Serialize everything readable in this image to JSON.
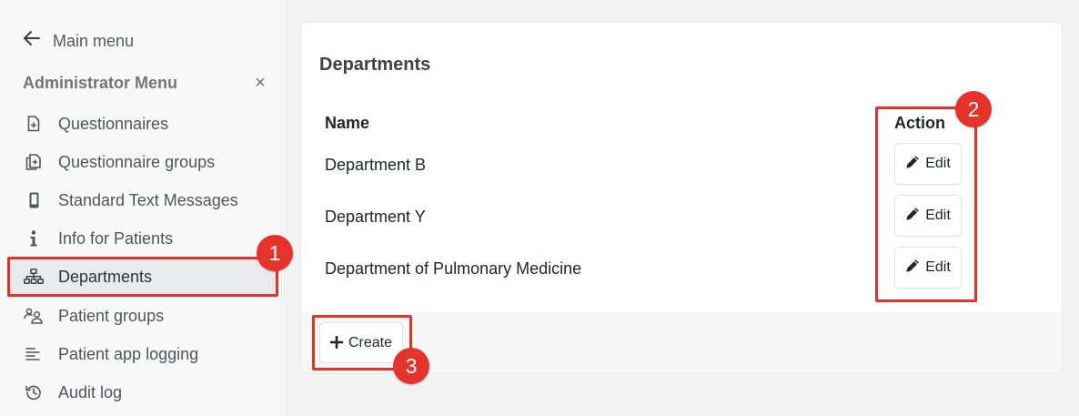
{
  "sidebar": {
    "back_label": "Main menu",
    "section_title": "Administrator Menu",
    "close_glyph": "×",
    "items": [
      {
        "label": "Questionnaires",
        "icon": "file-plus-icon"
      },
      {
        "label": "Questionnaire groups",
        "icon": "files-plus-icon"
      },
      {
        "label": "Standard Text Messages",
        "icon": "mobile-icon"
      },
      {
        "label": "Info for Patients",
        "icon": "info-icon"
      },
      {
        "label": "Departments",
        "icon": "sitemap-icon",
        "active": true
      },
      {
        "label": "Patient groups",
        "icon": "users-icon"
      },
      {
        "label": "Patient app logging",
        "icon": "list-icon"
      },
      {
        "label": "Audit log",
        "icon": "history-icon"
      }
    ]
  },
  "main": {
    "title": "Departments",
    "table": {
      "headers": {
        "name": "Name",
        "action": "Action"
      },
      "rows": [
        {
          "name": "Department B",
          "action": "Edit"
        },
        {
          "name": "Department Y",
          "action": "Edit"
        },
        {
          "name": "Department of Pulmonary Medicine",
          "action": "Edit"
        }
      ]
    },
    "create_label": "Create"
  },
  "annotations": {
    "badges": [
      "1",
      "2",
      "3"
    ],
    "color": "#e2332b"
  }
}
